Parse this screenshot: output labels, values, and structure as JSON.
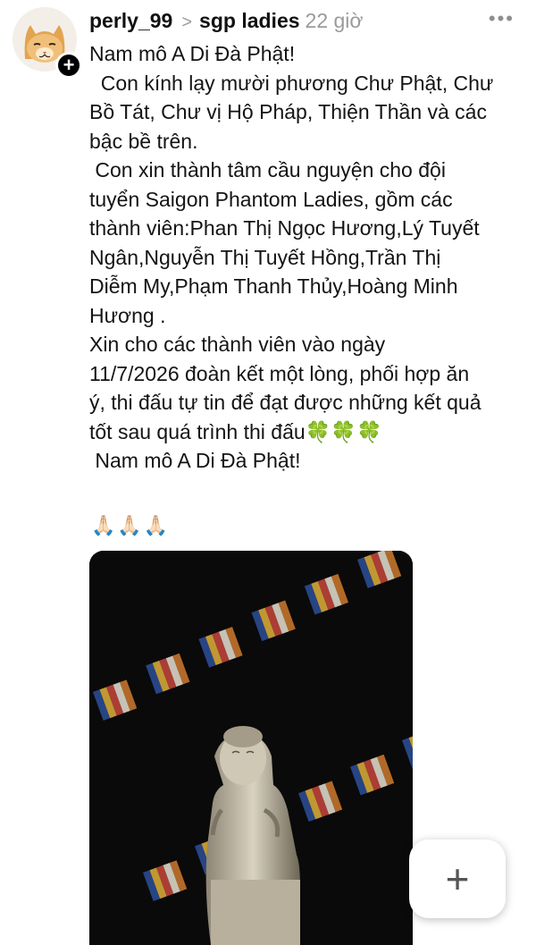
{
  "post": {
    "username": "perly_99",
    "separator": ">",
    "group": "sgp ladies",
    "time": "22 giờ",
    "more_label": "•••",
    "follow_label": "+",
    "text_lines": [
      "Nam mô A Di Đà Phật!",
      "  Con kính lạy mười phương Chư Phật, Chư",
      "Bồ Tát, Chư vị Hộ Pháp, Thiện Thần và các",
      "bậc bề trên.",
      " Con xin thành tâm cầu nguyện cho đội",
      "tuyển Saigon Phantom Ladies, gồm các",
      "thành viên:Phan Thị Ngọc Hương,Lý Tuyết",
      "Ngân,Nguyễn Thị Tuyết Hồng,Trần Thị",
      "Diễm My,Phạm Thanh Thủy,Hoàng Minh",
      "Hương .",
      "Xin cho các thành viên vào ngày",
      "11/7/2026 đoàn kết một lòng, phối hợp ăn",
      "ý, thi đấu tự tin để đạt được những kết quả",
      "tốt sau quá trình thi đấu🍀🍀🍀",
      " Nam mô A Di Đà Phật!"
    ],
    "emoji_line": "🙏🏻🙏🏻🙏🏻"
  },
  "fab": {
    "label": "+"
  },
  "colors": {
    "text": "#141414",
    "muted": "#9a9a9a",
    "photo_bg": "#0a0a0a"
  }
}
